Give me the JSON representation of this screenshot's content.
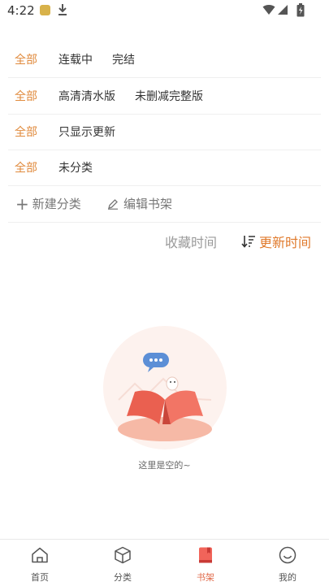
{
  "status": {
    "time": "4:22"
  },
  "filters": [
    {
      "selected": "全部",
      "options": [
        "连载中",
        "完结"
      ]
    },
    {
      "selected": "全部",
      "options": [
        "高清清水版",
        "未删减完整版"
      ]
    },
    {
      "selected": "全部",
      "options": [
        "只显示更新"
      ]
    },
    {
      "selected": "全部",
      "options": [
        "未分类"
      ]
    }
  ],
  "actions": {
    "new_category": "新建分类",
    "edit_shelf": "编辑书架"
  },
  "sort": {
    "favorite_time": "收藏时间",
    "update_time": "更新时间",
    "active": "更新时间"
  },
  "empty": {
    "text": "这里是空的~"
  },
  "nav": [
    {
      "label": "首页",
      "icon": "home-icon"
    },
    {
      "label": "分类",
      "icon": "box-icon"
    },
    {
      "label": "书架",
      "icon": "bookshelf-icon",
      "active": true
    },
    {
      "label": "我的",
      "icon": "smile-icon"
    }
  ],
  "colors": {
    "accent": "#e08a3c",
    "sort_active": "#e07a2c",
    "nav_active": "#e06a4a"
  }
}
